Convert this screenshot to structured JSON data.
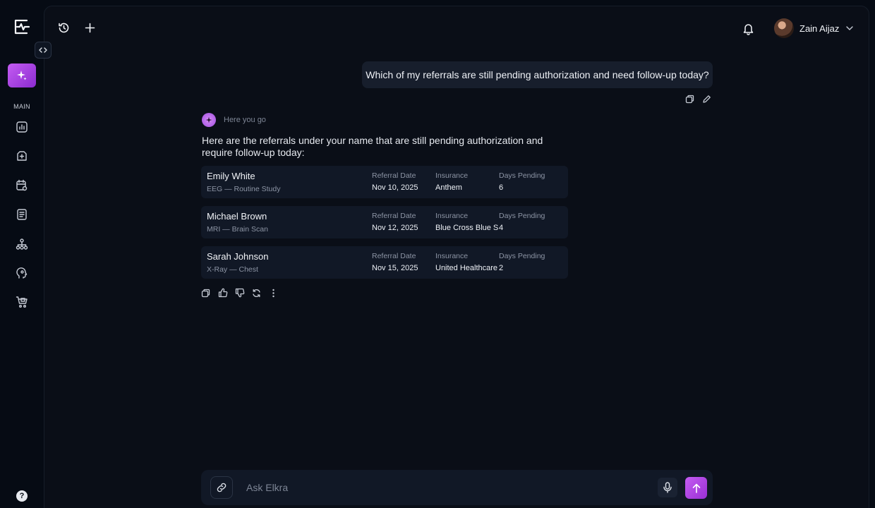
{
  "sidebar": {
    "section_label": "MAIN",
    "help_label": "?"
  },
  "header": {
    "user_name": "Zain Aijaz"
  },
  "chat": {
    "user_message": "Which of my referrals are still pending authorization and need follow-up today?",
    "bot_label": "Here you go",
    "bot_intro": "Here are the referrals under your name that are still pending authorization and require follow-up today:",
    "columns": {
      "date": "Referral Date",
      "insurance": "Insurance",
      "days": "Days Pending"
    },
    "referrals": [
      {
        "name": "Emily White",
        "detail": "EEG — Routine Study",
        "date": "Nov 10, 2025",
        "insurance": "Anthem",
        "days": "6"
      },
      {
        "name": "Michael Brown",
        "detail": "MRI — Brain Scan",
        "date": "Nov 12, 2025",
        "insurance": "Blue Cross Blue S...",
        "days": "4"
      },
      {
        "name": "Sarah Johnson",
        "detail": "X-Ray — Chest",
        "date": "Nov 15, 2025",
        "insurance": "United Healthcare",
        "days": "2"
      }
    ]
  },
  "composer": {
    "placeholder": "Ask Elkra"
  },
  "colors": {
    "accent": "#b84ae6",
    "background": "#0a0e17",
    "card": "#111826"
  }
}
